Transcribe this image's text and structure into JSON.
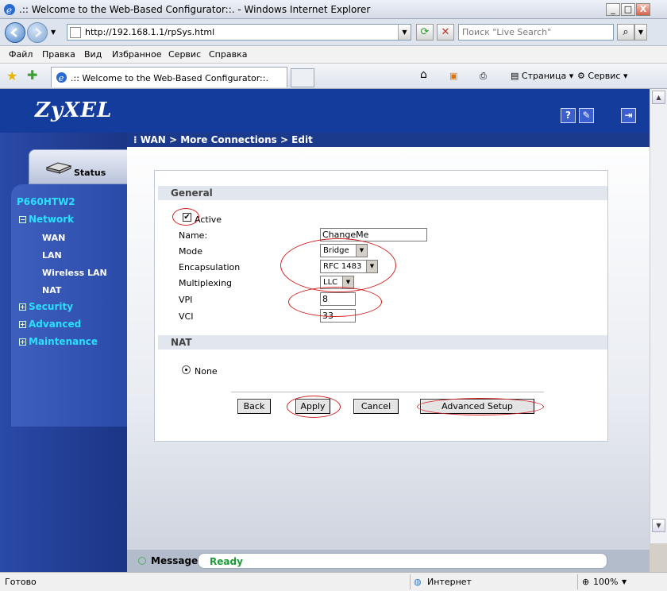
{
  "window": {
    "title": ".:: Welcome to the Web-Based Configurator::. - Windows Internet Explorer",
    "minimize": "_",
    "maximize": "□",
    "close": "X"
  },
  "address": {
    "url": "http://192.168.1.1/rpSys.html",
    "search_placeholder": "Поиск \"Live Search\""
  },
  "menu": [
    "Файл",
    "Правка",
    "Вид",
    "Избранное",
    "Сервис",
    "Справка"
  ],
  "tabs": {
    "active_tab": ".:: Welcome to the Web-Based Configurator::."
  },
  "commandbar": {
    "page": "Страница",
    "tools": "Сервис"
  },
  "router": {
    "brand": "ZyXEL",
    "status_tab": "Status",
    "model": "P660HTW2",
    "nav": {
      "network": "Network",
      "wan": "WAN",
      "lan": "LAN",
      "wireless_lan": "Wireless LAN",
      "nat": "NAT",
      "security": "Security",
      "advanced": "Advanced",
      "maintenance": "Maintenance"
    },
    "breadcrumb": "WAN > More Connections > Edit",
    "general": {
      "heading": "General",
      "active_label": "Active",
      "active_checked": "✔",
      "name_label": "Name:",
      "name_value": "ChangeMe",
      "mode_label": "Mode",
      "mode_value": "Bridge",
      "encapsulation_label": "Encapsulation",
      "encapsulation_value": "RFC 1483",
      "multiplexing_label": "Multiplexing",
      "multiplexing_value": "LLC",
      "vpi_label": "VPI",
      "vpi_value": "8",
      "vci_label": "VCI",
      "vci_value": "33"
    },
    "nat": {
      "heading": "NAT",
      "none_label": "None"
    },
    "buttons": {
      "back": "Back",
      "apply": "Apply",
      "cancel": "Cancel",
      "advanced_setup": "Advanced Setup"
    },
    "message": {
      "label": "Message",
      "status": "Ready"
    }
  },
  "statusbar": {
    "left": "Готово",
    "zone": "Интернет",
    "zoom": "100%"
  },
  "colors": {
    "annotation": "#d02020",
    "zyxel_blue": "#143c9c",
    "nav_cyan": "#2be0ff",
    "ready_green": "#1e9a3a"
  }
}
